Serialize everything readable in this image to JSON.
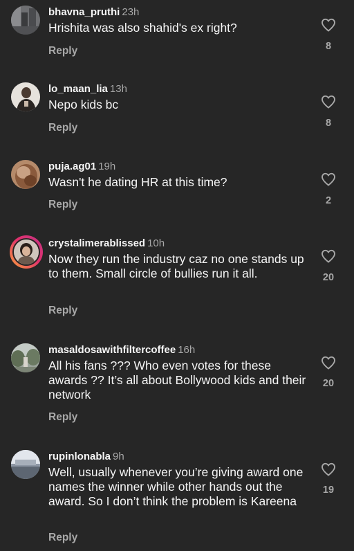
{
  "comments": [
    {
      "username": "bhavna_pruthi",
      "time": "23h",
      "text": "Hrishita was also shahid's ex right?",
      "reply_label": "Reply",
      "likes": "8"
    },
    {
      "username": "lo_maan_lia",
      "time": "13h",
      "text": "Nepo kids bc",
      "reply_label": "Reply",
      "likes": "8"
    },
    {
      "username": "puja.ag01",
      "time": "19h",
      "text": "Wasn't he dating HR at this time?",
      "reply_label": "Reply",
      "likes": "2"
    },
    {
      "username": "crystalimerablissed",
      "time": "10h",
      "text": "Now they run the industry caz no one stands up to them. Small circle of bullies run it all.",
      "reply_label": "Reply",
      "likes": "20"
    },
    {
      "username": "masaldosawithfiltercoffee",
      "time": "16h",
      "text": "All his fans ??? Who even votes for these awards ?? It’s all about Bollywood kids and their network",
      "reply_label": "Reply",
      "likes": "20"
    },
    {
      "username": "rupinlonabla",
      "time": "9h",
      "text": "Well, usually whenever you’re giving award one names the winner while other hands out the award. So I don’t think the problem is Kareena",
      "reply_label": "Reply",
      "likes": "19"
    }
  ],
  "icons": {
    "like": "heart-outline-icon"
  },
  "colors": {
    "background": "#262626",
    "primary_text": "#f5f5f5",
    "secondary_text": "#a8a8a8"
  }
}
